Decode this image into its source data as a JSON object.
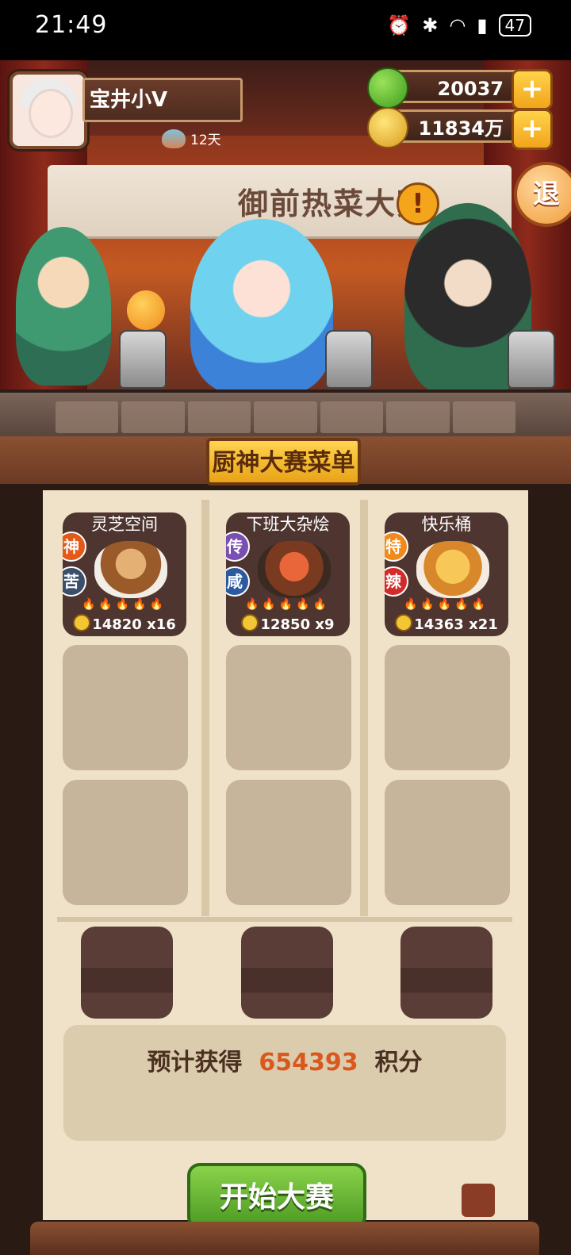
{
  "status_bar": {
    "time": "21:49",
    "battery": "47"
  },
  "player": {
    "name": "宝井小V",
    "days": "12天"
  },
  "currency": {
    "apples": "20037",
    "coins": "11834万",
    "plus_symbol": "+"
  },
  "exit_label": "退",
  "event_banner": {
    "title": "御前热菜大赛",
    "alert_symbol": "!"
  },
  "menu_title": "厨神大赛菜单",
  "dishes": [
    {
      "name": "灵芝空间",
      "rank": "神",
      "flavor": "苦",
      "price": "14820",
      "count": "x16"
    },
    {
      "name": "下班大杂烩",
      "rank": "传",
      "flavor": "咸",
      "price": "12850",
      "count": "x9"
    },
    {
      "name": "快乐桶",
      "rank": "特",
      "flavor": "辣",
      "price": "14363",
      "count": "x21"
    }
  ],
  "estimate": {
    "prefix": "预计获得",
    "points": "654393",
    "suffix": "积分"
  },
  "start_button": "开始大赛",
  "colors": {
    "points_orange": "#d9581e",
    "start_green": "#5ea82c",
    "menu_gold": "#f1b528"
  }
}
